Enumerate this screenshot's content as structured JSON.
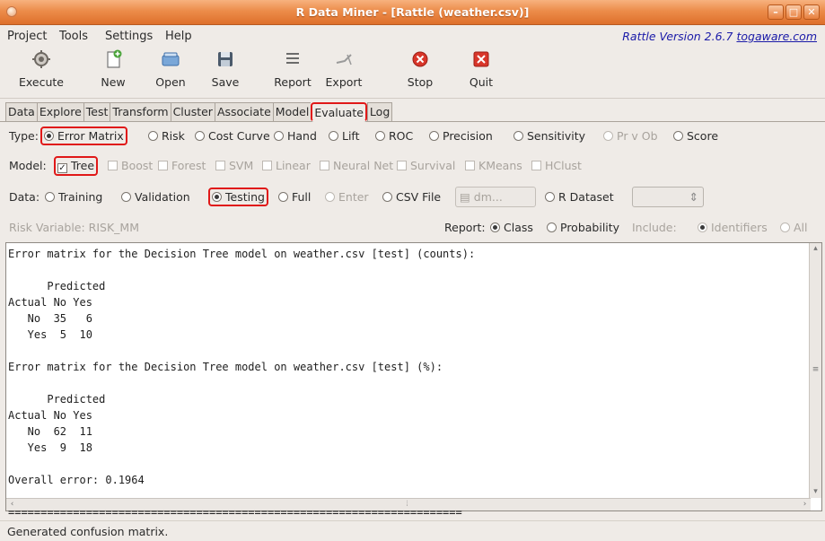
{
  "window": {
    "title": "R Data Miner - [Rattle (weather.csv)]",
    "controls": [
      "–",
      "□",
      "✕"
    ]
  },
  "menu": {
    "items": [
      "Project",
      "Tools",
      "Settings",
      "Help"
    ],
    "version_prefix": "Rattle Version 2.6.7 ",
    "version_link": "togaware.com"
  },
  "toolbar": {
    "execute": "Execute",
    "new": "New",
    "open": "Open",
    "save": "Save",
    "report": "Report",
    "export": "Export",
    "stop": "Stop",
    "quit": "Quit"
  },
  "tabs": [
    "Data",
    "Explore",
    "Test",
    "Transform",
    "Cluster",
    "Associate",
    "Model",
    "Evaluate",
    "Log"
  ],
  "active_tab": "Evaluate",
  "type_row": {
    "label": "Type:",
    "options": [
      "Error Matrix",
      "Risk",
      "Cost Curve",
      "Hand",
      "Lift",
      "ROC",
      "Precision",
      "Sensitivity",
      "Pr v Ob",
      "Score"
    ],
    "selected": "Error Matrix"
  },
  "model_row": {
    "label": "Model:",
    "options": [
      "Tree",
      "Boost",
      "Forest",
      "SVM",
      "Linear",
      "Neural Net",
      "Survival",
      "KMeans",
      "HClust"
    ],
    "checked": "Tree"
  },
  "data_row": {
    "label": "Data:",
    "training": "Training",
    "validation": "Validation",
    "testing": "Testing",
    "full": "Full",
    "enter": "Enter",
    "csv_file": "CSV File",
    "file_button": "dm...",
    "r_dataset": "R Dataset",
    "selected": "Testing"
  },
  "risk_row": {
    "risk_variable": "Risk Variable: RISK_MM",
    "report_label": "Report:",
    "class": "Class",
    "probability": "Probability",
    "include_label": "Include:",
    "identifiers": "Identifiers",
    "all": "All"
  },
  "output": {
    "text": "Error matrix for the Decision Tree model on weather.csv [test] (counts):\n\n      Predicted\nActual No Yes\n   No  35   6\n   Yes  5  10\n\nError matrix for the Decision Tree model on weather.csv [test] (%):\n\n      Predicted\nActual No Yes\n   No  62  11\n   Yes  9  18\n\nOverall error: 0.1964\n\n======================================================================"
  },
  "status": "Generated confusion matrix.",
  "colors": {
    "title_bar": "#e37a38",
    "highlight": "#e01818",
    "link": "#1a1aa8"
  }
}
